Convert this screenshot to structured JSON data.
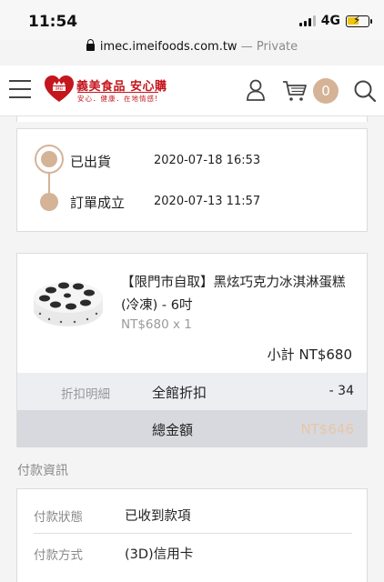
{
  "status_bar": {
    "time": "11:54",
    "network": "4G"
  },
  "browser": {
    "domain": "imec.imeifoods.com.tw",
    "private_label": " — Private"
  },
  "header": {
    "logo_title": "義美食品 安心購",
    "logo_slogan": "安心．健康．在地情感!",
    "logo_mark_text": "IMEI",
    "cart_count": "0",
    "brand_color": "#c4161c",
    "accent_color": "#d5b397"
  },
  "timeline": [
    {
      "status": "已出貨",
      "time": "2020-07-18 16:53"
    },
    {
      "status": "訂單成立",
      "time": "2020-07-13 11:57"
    }
  ],
  "product": {
    "name": "【限門市自取】黑炫巧克力冰淇淋蛋糕(冷凍) - 6吋",
    "price_qty": "NT$680 x 1",
    "subtotal": "小計 NT$680"
  },
  "discount": {
    "label": "折扣明細",
    "name": "全館折扣",
    "value": "- 34"
  },
  "total": {
    "label": "總金額",
    "value": "NT$646"
  },
  "payment": {
    "section_title": "付款資訊",
    "rows": [
      {
        "label": "付款狀態",
        "value": "已收到款項"
      },
      {
        "label": "付款方式",
        "value": "(3D)信用卡"
      }
    ]
  }
}
